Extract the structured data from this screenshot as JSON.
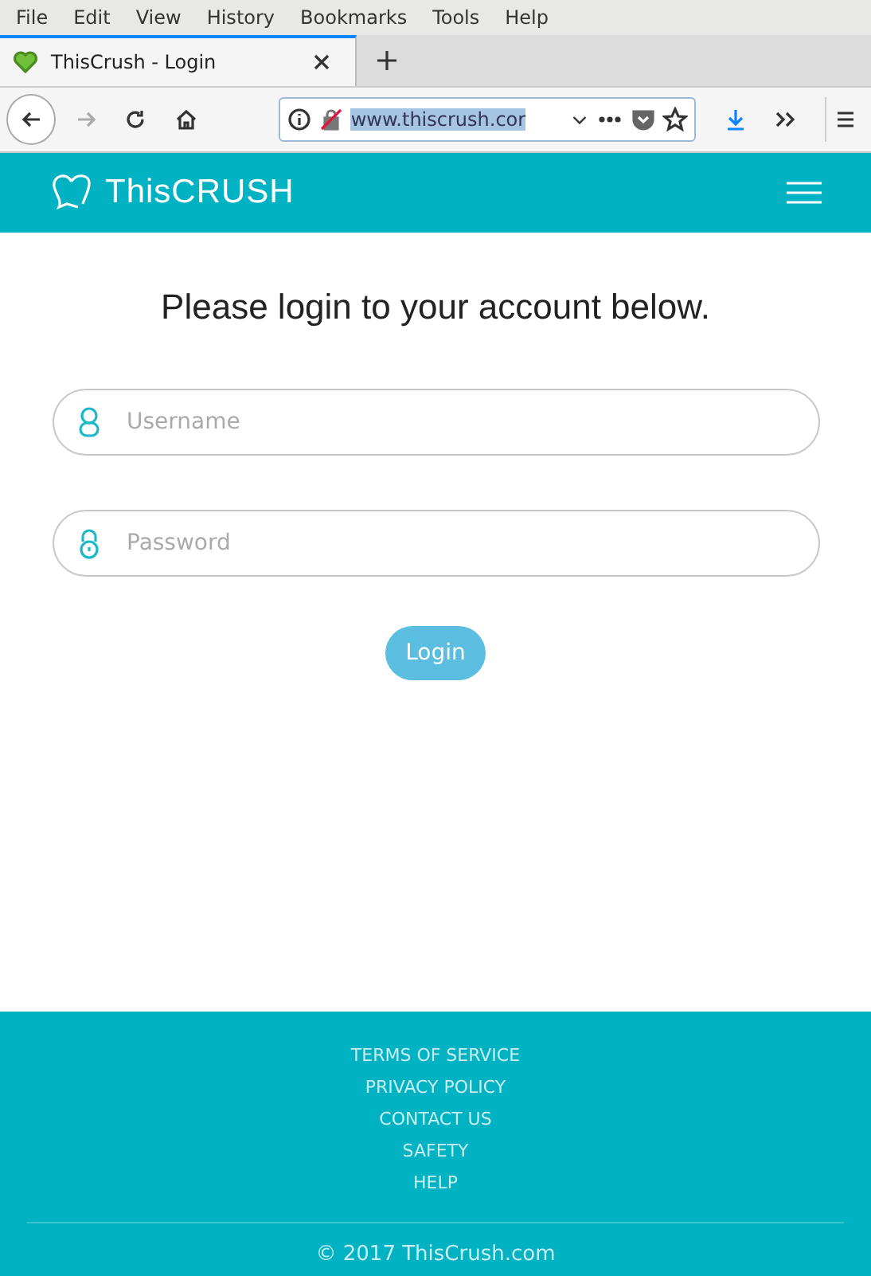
{
  "menu_bar": [
    "File",
    "Edit",
    "View",
    "History",
    "Bookmarks",
    "Tools",
    "Help"
  ],
  "tabs": [
    {
      "title": "ThisCrush - Login",
      "selected": true
    }
  ],
  "address_bar": {
    "url": "www.thiscrush.cor"
  },
  "site": {
    "brand": "ThisCRUSH",
    "heading": "Please login to your account below.",
    "fields": [
      {
        "kind": "user",
        "placeholder": "Username"
      },
      {
        "kind": "lock",
        "placeholder": "Password"
      }
    ],
    "login_button": "Login",
    "footer_links": [
      "TERMS OF SERVICE",
      "PRIVACY POLICY",
      "CONTACT US",
      "SAFETY",
      "HELP"
    ],
    "copyright": "© 2017 ThisCrush.com"
  }
}
